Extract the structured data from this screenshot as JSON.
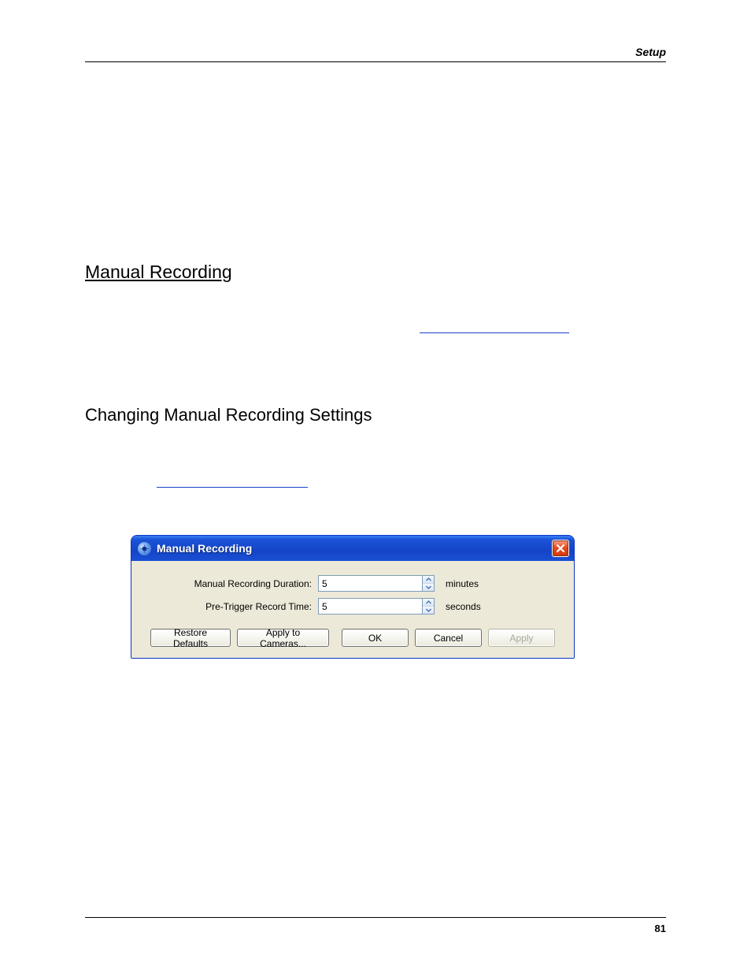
{
  "header": {
    "section": "Setup"
  },
  "footer": {
    "page": "81"
  },
  "section": {
    "title": "Manual Recording",
    "subtitle": "Changing Manual Recording Settings"
  },
  "dialog": {
    "icon_name": "record-icon",
    "title": "Manual Recording",
    "close_name": "close-icon",
    "fields": {
      "duration": {
        "label": "Manual Recording Duration:",
        "value": "5",
        "unit": "minutes"
      },
      "pretrigger": {
        "label": "Pre-Trigger Record Time:",
        "value": "5",
        "unit": "seconds"
      }
    },
    "buttons": {
      "restore": "Restore Defaults",
      "apply_cams": "Apply to Cameras...",
      "ok": "OK",
      "cancel": "Cancel",
      "apply": "Apply"
    }
  }
}
